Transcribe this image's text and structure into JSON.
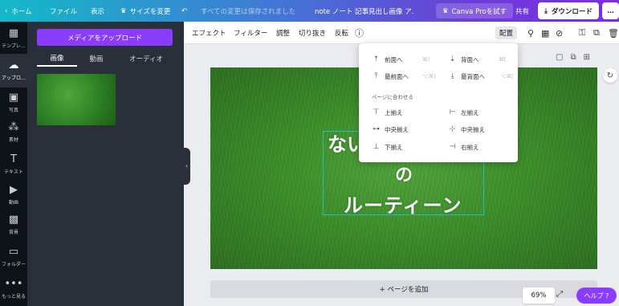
{
  "topbar": {
    "home": "ホーム",
    "file": "ファイル",
    "view": "表示",
    "resize": "サイズを変更",
    "saved_status": "すべての変更は保存されました",
    "doc_title": "note ノート 記事見出し画像 ア.",
    "pro_button": "Canva Proを試す",
    "share": "共有",
    "download": "ダウンロード",
    "more": "…"
  },
  "rail": {
    "items": [
      {
        "label": "テンプレ…",
        "icon": "template-icon"
      },
      {
        "label": "アップロ…",
        "icon": "upload-cloud-icon"
      },
      {
        "label": "写真",
        "icon": "photo-icon"
      },
      {
        "label": "素材",
        "icon": "elements-icon"
      },
      {
        "label": "テキスト",
        "icon": "text-icon"
      },
      {
        "label": "動画",
        "icon": "video-icon"
      },
      {
        "label": "背景",
        "icon": "background-icon"
      },
      {
        "label": "フォルダー",
        "icon": "folder-icon"
      },
      {
        "label": "もっと見る",
        "icon": "more-icon"
      }
    ]
  },
  "panel": {
    "upload_button": "メディアをアップロード",
    "tabs": [
      "画像",
      "動画",
      "オーディオ"
    ],
    "active_tab": "画像"
  },
  "toolbar": {
    "effects": "エフェクト",
    "filter": "フィルター",
    "adjust": "調整",
    "crop": "切り抜き",
    "flip": "反転",
    "arrange": "配置"
  },
  "canvas": {
    "lines": [
      "ない",
      "の",
      "ルーティーン"
    ],
    "add_page": "+ ページを追加",
    "zoom": "69%",
    "help": "ヘルプ ?"
  },
  "arrange_menu": {
    "forward": "前面へ",
    "forward_shortcut": "⌘]",
    "backward": "背面へ",
    "backward_shortcut": "⌘[",
    "to_front": "最前面へ",
    "to_front_shortcut": "⌥⌘]",
    "to_back": "最背面へ",
    "to_back_shortcut": "⌥⌘[",
    "section_label": "ページに合わせる",
    "align_top": "上揃え",
    "align_left": "左揃え",
    "align_middle": "中央揃え",
    "align_center": "中央揃え",
    "align_bottom": "下揃え",
    "align_right": "右揃え"
  },
  "colors": {
    "accent": "#8b3dff",
    "selection": "#1fc2b4",
    "rail_bg": "#0e1318",
    "panel_bg": "#293039"
  }
}
